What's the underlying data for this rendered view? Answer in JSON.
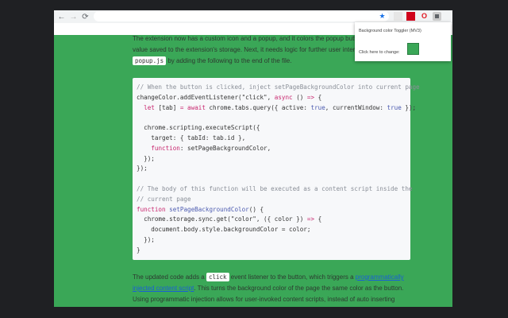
{
  "browser": {
    "back": "←",
    "forward": "→",
    "reload": "⟳",
    "star": "★"
  },
  "extensions": [
    {
      "name": "ext-grid-icon",
      "color": "#ddd"
    },
    {
      "name": "ext-red-icon",
      "color": "#d0021b"
    },
    {
      "name": "ext-opera-icon",
      "color": "#e0141e"
    },
    {
      "name": "ext-toggler-icon",
      "color": "#5f6368"
    }
  ],
  "popup": {
    "title": "Background color Toggler (MV3)",
    "label": "Click here to change:",
    "button_color": "#3aa757"
  },
  "intro": {
    "line1": "The extension now has a custom icon and a popup, and it colors the popup button based on a",
    "line2": "value saved to the extension's storage. Next, it needs logic for further user interaction. Update",
    "code": "popup.js",
    "line3": " by adding the following to the end of the file."
  },
  "code_lines": [
    [
      [
        "// When the button is clicked, inject setPageBackgroundColor into current page",
        "c"
      ]
    ],
    [
      [
        "changeColor.addEventListener(",
        "p"
      ],
      [
        "\"click\"",
        "s"
      ],
      [
        ", ",
        "p"
      ],
      [
        "async",
        "k"
      ],
      [
        " () ",
        "p"
      ],
      [
        "=>",
        "k"
      ],
      [
        " {",
        "p"
      ]
    ],
    [
      [
        "  ",
        "p"
      ],
      [
        "let",
        "k"
      ],
      [
        " [tab] ",
        "p"
      ],
      [
        "=",
        "k"
      ],
      [
        " ",
        "p"
      ],
      [
        "await",
        "k"
      ],
      [
        " chrome.tabs.query({ active: ",
        "p"
      ],
      [
        "true",
        "v"
      ],
      [
        ", currentWindow: ",
        "p"
      ],
      [
        "true",
        "v"
      ],
      [
        " });",
        "p"
      ]
    ],
    [
      [
        "",
        "p"
      ]
    ],
    [
      [
        "  chrome.scripting.executeScript({",
        "p"
      ]
    ],
    [
      [
        "    target: { tabId: tab.id },",
        "p"
      ]
    ],
    [
      [
        "    ",
        "p"
      ],
      [
        "function",
        "k"
      ],
      [
        ": setPageBackgroundColor,",
        "p"
      ]
    ],
    [
      [
        "  });",
        "p"
      ]
    ],
    [
      [
        "});",
        "p"
      ]
    ],
    [
      [
        "",
        "p"
      ]
    ],
    [
      [
        "// The body of this function will be executed as a content script inside the",
        "c"
      ]
    ],
    [
      [
        "// current page",
        "c"
      ]
    ],
    [
      [
        "function",
        "k"
      ],
      [
        " ",
        "p"
      ],
      [
        "setPageBackgroundColor",
        "v"
      ],
      [
        "() {",
        "p"
      ]
    ],
    [
      [
        "  chrome.storage.sync.get(",
        "p"
      ],
      [
        "\"color\"",
        "s"
      ],
      [
        ", ({ color }) ",
        "p"
      ],
      [
        "=>",
        "k"
      ],
      [
        " {",
        "p"
      ]
    ],
    [
      [
        "    document.body.style.backgroundColor = color;",
        "p"
      ]
    ],
    [
      [
        "  });",
        "p"
      ]
    ],
    [
      [
        "}",
        "p"
      ]
    ]
  ],
  "outro": {
    "t1": "The updated code adds a ",
    "code": "click",
    "t2": " event listener to the button, which triggers a ",
    "link1": "programmatically",
    "link2": "injected content script",
    "t3": ". This turns the background color of the page the same color as the button.",
    "line3": "Using programmatic injection allows for user-invoked content scripts, instead of auto inserting"
  }
}
